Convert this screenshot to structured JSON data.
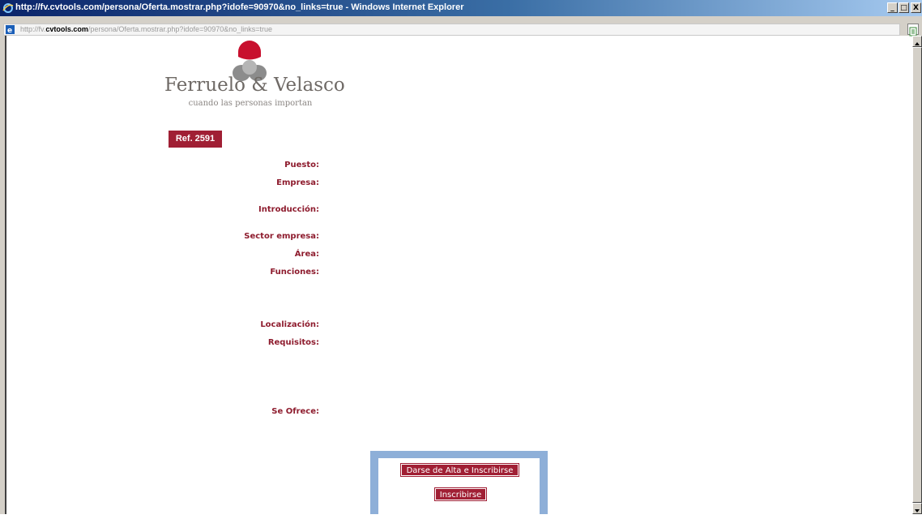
{
  "window": {
    "title": "http://fv.cvtools.com/persona/Oferta.mostrar.php?idofe=90970&no_links=true - Windows Internet Explorer",
    "minimize": "_",
    "maximize": "□",
    "close": "X"
  },
  "address": {
    "prefix": "http://fv.",
    "host": "cvtools.com",
    "path": "/persona/Oferta.mostrar.php?idofe=90970&no_links=true"
  },
  "logo": {
    "name": "Ferruelo & Velasco",
    "tagline": "cuando las personas importan",
    "colors": {
      "red": "#c8102e",
      "grey": "#8c8c8c"
    }
  },
  "offer": {
    "reference": "Ref. 2591",
    "fields": [
      {
        "label": "Puesto:",
        "value": ""
      },
      {
        "label": "Empresa:",
        "value": ""
      },
      {
        "label": "Introducción:",
        "value": ""
      },
      {
        "label": "Sector empresa:",
        "value": ""
      },
      {
        "label": "Área:",
        "value": ""
      },
      {
        "label": "Funciones:",
        "value": ""
      },
      {
        "label": "Localización:",
        "value": ""
      },
      {
        "label": "Requisitos:",
        "value": ""
      },
      {
        "label": "Se Ofrece:",
        "value": ""
      }
    ]
  },
  "actions": {
    "register_and_apply": "Darse de Alta e Inscribirse",
    "apply": "Inscribirse"
  },
  "colors": {
    "brand": "#a01f34",
    "label": "#8e1c2e",
    "box_border": "#8eafd8"
  }
}
